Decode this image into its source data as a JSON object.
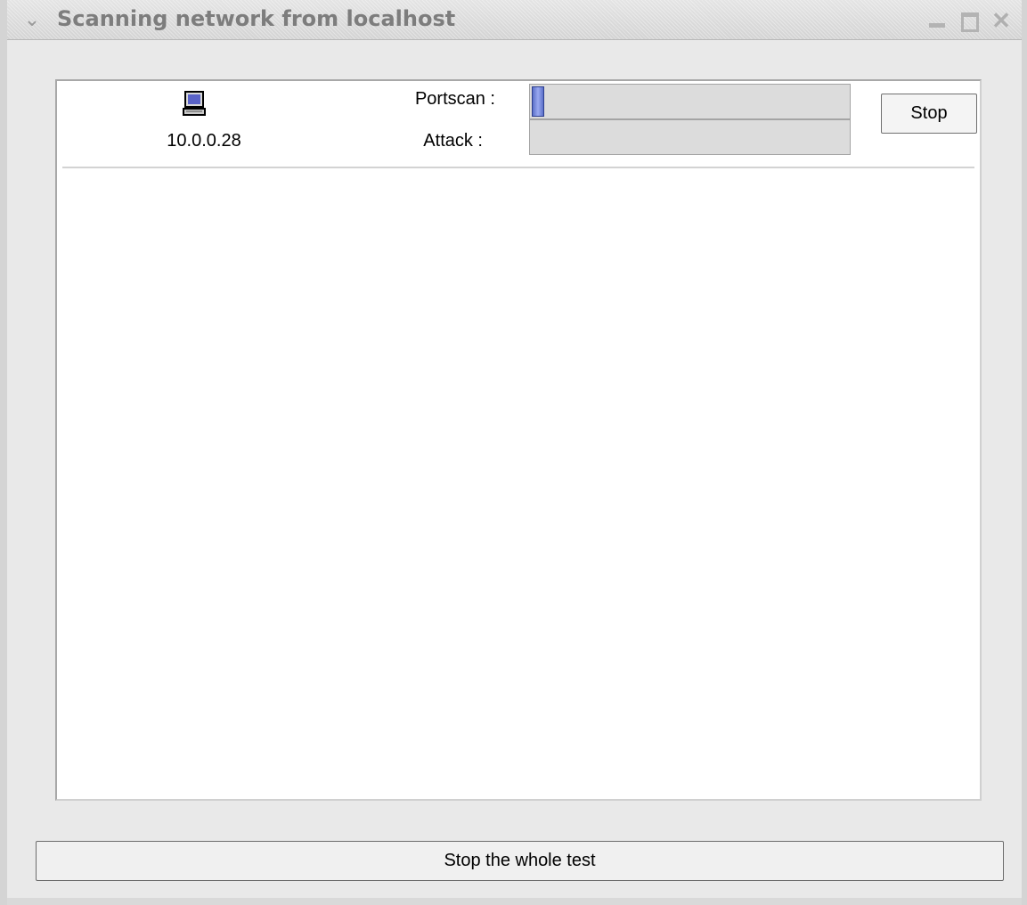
{
  "window": {
    "title": "Scanning network from localhost"
  },
  "host": {
    "icon": "computer-icon",
    "ip": "10.0.0.28",
    "portscan_label": "Portscan :",
    "attack_label": "Attack :",
    "portscan_progress": 0.04,
    "attack_progress": 0,
    "stop_label": "Stop"
  },
  "footer": {
    "stop_all_label": "Stop the whole test"
  },
  "colors": {
    "progress_fill": "#6b7fd6"
  }
}
